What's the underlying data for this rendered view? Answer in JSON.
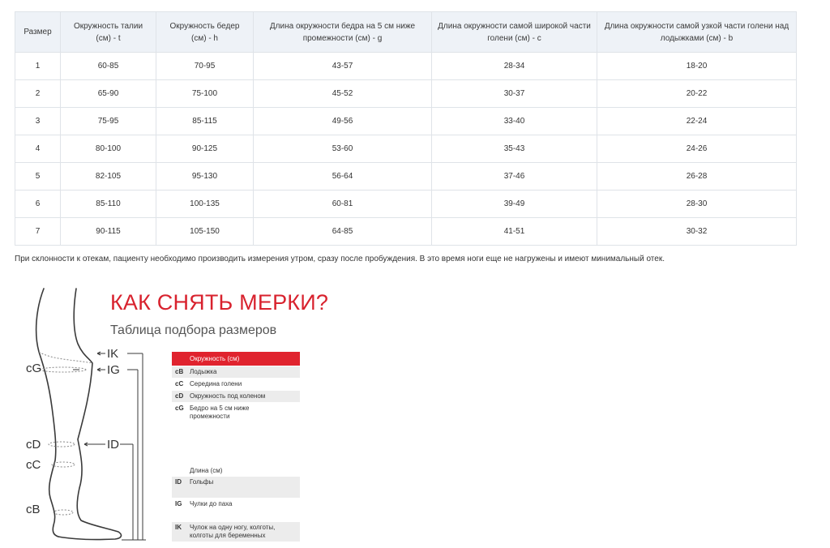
{
  "table": {
    "headers": [
      "Размер",
      "Окружность талии (см) - t",
      "Окружность бедер (см) - h",
      "Длина окружности бедра на 5 см ниже промежности (см) - g",
      "Длина окружности самой широкой части голени (см) - c",
      "Длина окружности самой узкой части голени над лодыжками (см) - b"
    ],
    "rows": [
      [
        "1",
        "60-85",
        "70-95",
        "43-57",
        "28-34",
        "18-20"
      ],
      [
        "2",
        "65-90",
        "75-100",
        "45-52",
        "30-37",
        "20-22"
      ],
      [
        "3",
        "75-95",
        "85-115",
        "49-56",
        "33-40",
        "22-24"
      ],
      [
        "4",
        "80-100",
        "90-125",
        "53-60",
        "35-43",
        "24-26"
      ],
      [
        "5",
        "82-105",
        "95-130",
        "56-64",
        "37-46",
        "26-28"
      ],
      [
        "6",
        "85-110",
        "100-135",
        "60-81",
        "39-49",
        "28-30"
      ],
      [
        "7",
        "90-115",
        "105-150",
        "64-85",
        "41-51",
        "30-32"
      ]
    ]
  },
  "note": "При склонности к отекам, пациенту необходимо производить измерения утром, сразу после пробуждения. В это время ноги еще не нагружены и имеют минимальный отек.",
  "guide": {
    "title": "КАК СНЯТЬ МЕРКИ?",
    "subtitle": "Таблица подбора размеров",
    "leg_labels": {
      "cG": "cG",
      "cD": "cD",
      "cC": "cC",
      "cB": "cB",
      "IK": "IK",
      "IG": "IG",
      "ID": "ID"
    },
    "circumference": {
      "header": "Окружность (см)",
      "items": [
        {
          "code": "cB",
          "label": "Лодыжка"
        },
        {
          "code": "cC",
          "label": "Середина голени"
        },
        {
          "code": "cD",
          "label": "Окружность под коленом"
        },
        {
          "code": "cG",
          "label": "Бедро на 5 см ниже промежности"
        }
      ]
    },
    "length": {
      "header": "Длина (см)",
      "items": [
        {
          "code": "ID",
          "label": "Гольфы"
        },
        {
          "code": "IG",
          "label": "Чулки до паха"
        },
        {
          "code": "IK",
          "label": "Чулок на одну ногу, колготы, колготы для беременных"
        }
      ]
    }
  },
  "colors": {
    "accent": "#e0232e",
    "title": "#d8222e",
    "header_bg": "#eef2f7",
    "border": "#dfe3e8"
  }
}
